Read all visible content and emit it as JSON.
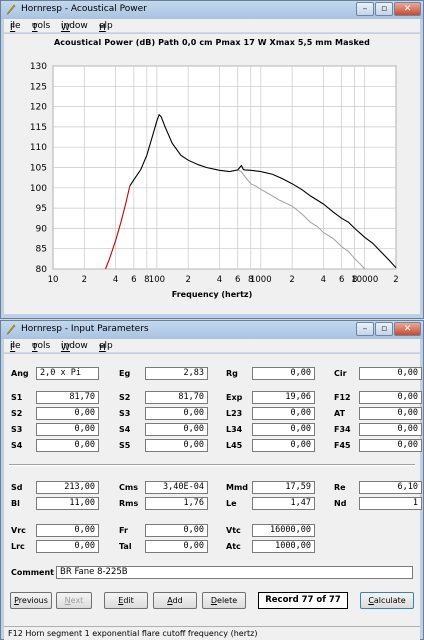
{
  "win1": {
    "title": "Hornresp - Acoustical Power",
    "menu": [
      "File",
      "Tools",
      "Window",
      "Help"
    ],
    "graph_title": "Acoustical Power (dB)   Path 0,0 cm   Pmax 17 W   Xmax 5,5 mm   Masked",
    "x_axis_label": "Frequency (hertz)"
  },
  "chart_data": {
    "type": "line",
    "title": "Acoustical Power (dB)   Path 0,0 cm   Pmax 17 W   Xmax 5,5 mm   Masked",
    "xlabel": "Frequency (hertz)",
    "ylabel": "",
    "xscale": "log",
    "xlim": [
      10,
      20000
    ],
    "ylim": [
      80,
      130
    ],
    "y_ticks": [
      "130",
      "125",
      "120",
      "115",
      "110",
      "105",
      "100",
      "95",
      "90",
      "85",
      "80"
    ],
    "x_ticks": [
      {
        "v": 10,
        "t": "10"
      },
      {
        "v": 20,
        "t": "2"
      },
      {
        "v": 40,
        "t": "4"
      },
      {
        "v": 60,
        "t": "6"
      },
      {
        "v": 80,
        "t": "8"
      },
      {
        "v": 100,
        "t": "100"
      },
      {
        "v": 200,
        "t": "2"
      },
      {
        "v": 400,
        "t": "4"
      },
      {
        "v": 600,
        "t": "6"
      },
      {
        "v": 800,
        "t": "8"
      },
      {
        "v": 1000,
        "t": "1000"
      },
      {
        "v": 2000,
        "t": "2"
      },
      {
        "v": 4000,
        "t": "4"
      },
      {
        "v": 6000,
        "t": "6"
      },
      {
        "v": 8000,
        "t": "8"
      },
      {
        "v": 10000,
        "t": "10000"
      },
      {
        "v": 20000,
        "t": "2"
      }
    ],
    "grid": true,
    "colors": {
      "main": "#000000",
      "masked": "#cc0000",
      "path": "#a8a8a8"
    },
    "series": [
      {
        "values": [
          [
            55,
            100.5
          ],
          [
            60,
            102
          ],
          [
            70,
            104.5
          ],
          [
            80,
            108
          ],
          [
            90,
            112.5
          ],
          [
            100,
            116.5
          ],
          [
            105,
            118
          ],
          [
            110,
            117.5
          ],
          [
            120,
            115
          ],
          [
            140,
            111
          ],
          [
            170,
            108
          ],
          [
            200,
            106.8
          ],
          [
            250,
            105.7
          ],
          [
            300,
            105
          ],
          [
            400,
            104.3
          ],
          [
            500,
            104
          ],
          [
            600,
            104.4
          ],
          [
            650,
            105.5
          ],
          [
            680,
            104.5
          ],
          [
            700,
            104.4
          ],
          [
            800,
            104.3
          ],
          [
            1000,
            104
          ],
          [
            1300,
            103.3
          ],
          [
            1600,
            102.3
          ],
          [
            2000,
            101
          ],
          [
            2500,
            99.5
          ],
          [
            3000,
            98
          ],
          [
            4000,
            96
          ],
          [
            5000,
            94
          ],
          [
            6000,
            92.5
          ],
          [
            7000,
            91.5
          ],
          [
            8000,
            90
          ],
          [
            10000,
            87.8
          ],
          [
            12000,
            86.3
          ],
          [
            14000,
            84.5
          ],
          [
            17000,
            82.3
          ],
          [
            20000,
            80.3
          ]
        ]
      },
      {
        "values": [
          [
            32,
            80
          ],
          [
            35,
            82.5
          ],
          [
            40,
            87
          ],
          [
            45,
            91.5
          ],
          [
            50,
            96
          ],
          [
            55,
            100.5
          ]
        ]
      },
      {
        "values": [
          [
            600,
            104.4
          ],
          [
            650,
            104
          ],
          [
            700,
            102.8
          ],
          [
            800,
            101
          ],
          [
            900,
            100.4
          ],
          [
            1000,
            99.6
          ],
          [
            1200,
            98.5
          ],
          [
            1500,
            97
          ],
          [
            2000,
            95.5
          ],
          [
            2500,
            93.5
          ],
          [
            3000,
            91.5
          ],
          [
            3500,
            90.5
          ],
          [
            4000,
            89
          ],
          [
            5000,
            87.5
          ],
          [
            6000,
            85.5
          ],
          [
            7000,
            84.3
          ],
          [
            8000,
            82.5
          ],
          [
            9000,
            81.3
          ],
          [
            10000,
            80
          ]
        ]
      }
    ]
  },
  "win2": {
    "title": "Hornresp - Input Parameters",
    "menu": [
      "File",
      "Tools",
      "Window",
      "Help"
    ],
    "params": {
      "Ang": "2,0 x Pi",
      "Eg": "2,83",
      "Rg": "0,00",
      "Cir": "0,00",
      "S1": "81,70",
      "S2": "81,70",
      "Exp": "19,06",
      "F12": "0,00",
      "S2b": "0,00",
      "S3": "0,00",
      "L23": "0,00",
      "AT": "0,00",
      "S3b": "0,00",
      "S4": "0,00",
      "L34": "0,00",
      "F34": "0,00",
      "S4b": "0,00",
      "S5": "0,00",
      "L45": "0,00",
      "F45": "0,00",
      "Sd": "213,00",
      "Cms": "3,40E-04",
      "Mmd": "17,59",
      "Re": "6,10",
      "Bl": "11,00",
      "Rms": "1,76",
      "Le": "1,47",
      "Nd": "1",
      "Vrc": "0,00",
      "Fr": "0,00",
      "Vtc": "16000,00",
      "Lrc": "0,00",
      "Tal": "0,00",
      "Atc": "1000,00"
    },
    "comment_label": "Comment",
    "comment": "BR Fane 8-225B",
    "buttons": {
      "previous": "Previous",
      "next": "Next",
      "edit": "Edit",
      "add": "Add",
      "delete": "Delete",
      "calculate": "Calculate"
    },
    "record": "Record 77 of 77",
    "status": "F12   Horn segment 1 exponential flare cutoff frequency  (hertz)"
  },
  "labels": {
    "c1": [
      "Ang",
      "S1",
      "S2",
      "S3",
      "S4"
    ],
    "c2": [
      "Eg",
      "S2",
      "S3",
      "S4",
      "S5"
    ],
    "c3": [
      "Rg",
      "Exp",
      "L23",
      "L34",
      "L45"
    ],
    "c4": [
      "Cir",
      "F12",
      "AT",
      "F34",
      "F45"
    ],
    "m1": [
      "Sd",
      "Bl"
    ],
    "m2": [
      "Cms",
      "Rms"
    ],
    "m3": [
      "Mmd",
      "Le"
    ],
    "m4": [
      "Re",
      "Nd"
    ],
    "b1": [
      "Vrc",
      "Lrc"
    ],
    "b2": [
      "Fr",
      "Tal"
    ],
    "b3": [
      "Vtc",
      "Atc"
    ]
  }
}
